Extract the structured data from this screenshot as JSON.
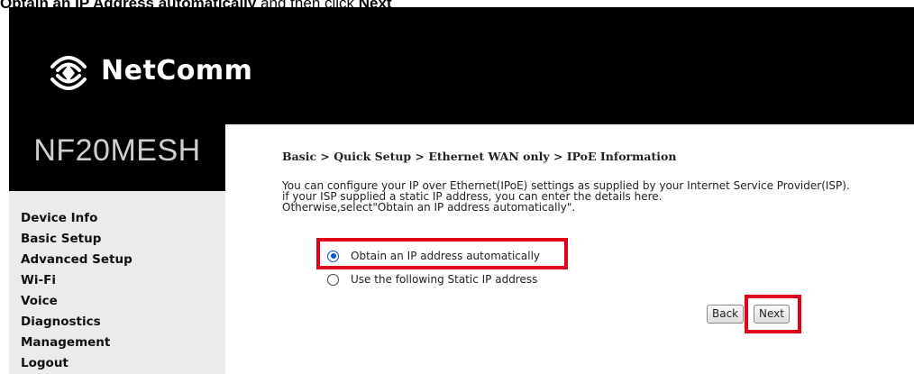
{
  "caption": {
    "bold_part": "Obtain an IP Address automatically",
    "rest": " and then click ",
    "bold_end": "Next"
  },
  "header": {
    "brand": "NetComm",
    "logo_icon": "wifi-signal-icon"
  },
  "model": "NF20MESH",
  "sidebar": {
    "items": [
      {
        "label": "Device Info"
      },
      {
        "label": "Basic Setup"
      },
      {
        "label": "Advanced Setup"
      },
      {
        "label": "Wi-Fi"
      },
      {
        "label": "Voice"
      },
      {
        "label": "Diagnostics"
      },
      {
        "label": "Management"
      },
      {
        "label": "Logout"
      }
    ]
  },
  "main": {
    "breadcrumb": "Basic > Quick Setup > Ethernet WAN only > IPoE Information",
    "description": [
      "You can configure your IP over Ethernet(IPoE) settings as supplied by your Internet Service Provider(ISP).",
      "if your ISP supplied a static IP address, you can enter the details here.",
      "Otherwise,select\"Obtain an IP address automatically\"."
    ],
    "options": [
      {
        "label": "Obtain an IP address automatically",
        "selected": true
      },
      {
        "label": "Use the following Static IP address",
        "selected": false
      }
    ],
    "buttons": {
      "back": "Back",
      "next": "Next"
    }
  },
  "colors": {
    "highlight": "#e0001a",
    "radio_selected": "#0055c8",
    "header_bg": "#000000",
    "sidebar_bg": "#ebebeb"
  }
}
